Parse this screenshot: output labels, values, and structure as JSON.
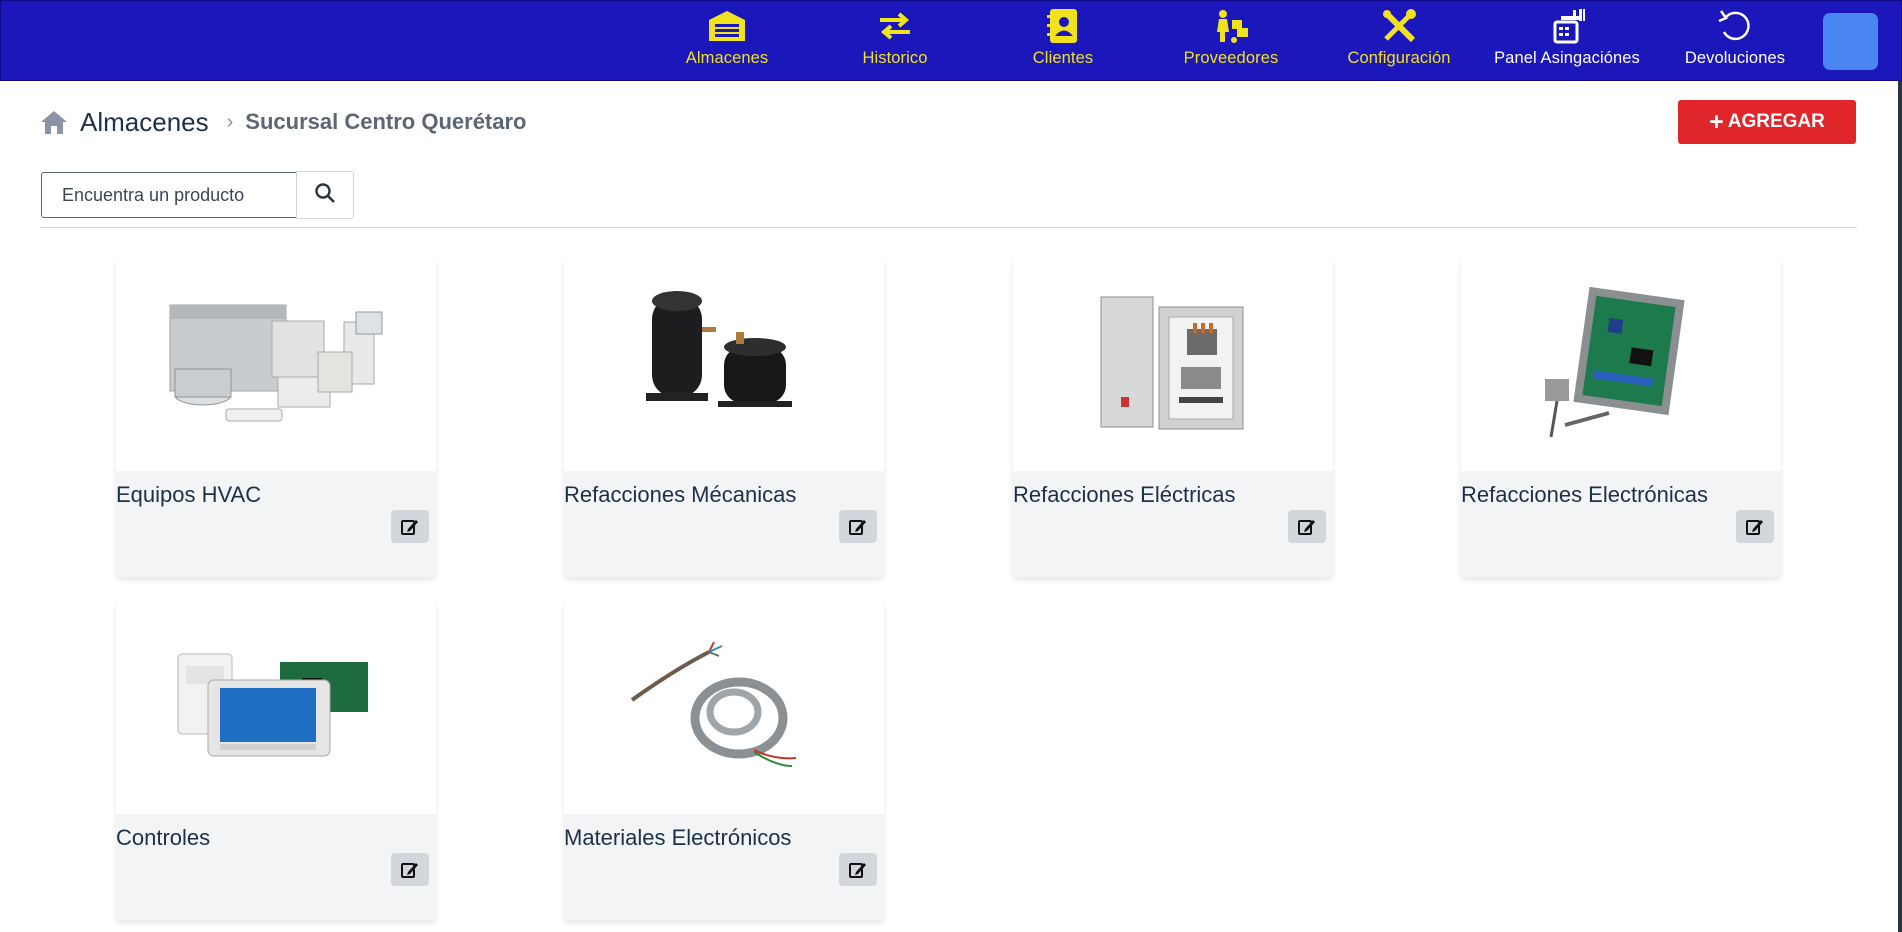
{
  "nav": {
    "items": [
      {
        "label": "Almacenes",
        "icon": "warehouse-icon"
      },
      {
        "label": "Historico",
        "icon": "exchange-arrows-icon"
      },
      {
        "label": "Clientes",
        "icon": "address-book-icon"
      },
      {
        "label": "Proveedores",
        "icon": "delivery-worker-icon"
      },
      {
        "label": "Configuración",
        "icon": "tools-icon"
      },
      {
        "label": "Panel Asingaciónes",
        "icon": "register-panel-icon"
      },
      {
        "label": "Devoluciones",
        "icon": "undo-icon"
      }
    ],
    "avatar_icon": "user-avatar"
  },
  "breadcrumb": {
    "home_icon": "home-icon",
    "root": "Almacenes",
    "separator": "›",
    "current": "Sucursal Centro Querétaro"
  },
  "actions": {
    "add_label": "AGREGAR",
    "add_icon": "plus-icon"
  },
  "search": {
    "placeholder": "Encuentra un producto",
    "value": "",
    "icon": "search-icon"
  },
  "categories": [
    {
      "title": "Equipos HVAC",
      "image": "hvac-equipment-image"
    },
    {
      "title": "Refacciones Mécanicas",
      "image": "compressor-image"
    },
    {
      "title": "Refacciones Eléctricas",
      "image": "electrical-panel-image"
    },
    {
      "title": "Refacciones Electrónicas",
      "image": "circuit-board-image"
    },
    {
      "title": "Controles",
      "image": "thermostat-controls-image"
    },
    {
      "title": "Materiales Electrónicos",
      "image": "cables-conduit-image"
    }
  ],
  "colors": {
    "navbar": "#1b17bb",
    "nav_text": "#f1e21e",
    "add_button": "#e0262a",
    "avatar": "#4a86f2"
  }
}
